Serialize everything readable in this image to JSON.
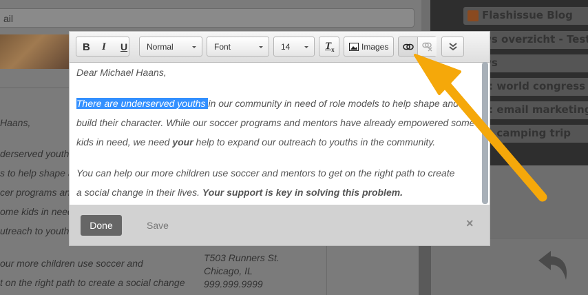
{
  "background": {
    "subject_value": "ail",
    "letter_lines": [
      "Haans,",
      "derserved youths",
      "s to help shape a",
      "cer programs an",
      "ome kids in need",
      "utreach to youths",
      "our more children use soccer and",
      "t on the right path to create a social change"
    ],
    "address": [
      "T503 Runners St.",
      "Chicago, IL",
      "999.999.9999"
    ],
    "sidebar_items": [
      "Flashissue Blog",
      "ws overzicht - Test se",
      "ws",
      "e: world congress",
      "e: email marketing",
      "e: camping trip"
    ]
  },
  "editor": {
    "toolbar": {
      "bold": "B",
      "italic": "I",
      "underline": "U",
      "format": "Normal",
      "font": "Font",
      "size": "14",
      "clear_format": "Tx",
      "images": "Images"
    },
    "content": {
      "greeting": "Dear Michael Haans,",
      "p1_selected": "There are underserved youths ",
      "p1_rest": "in our community in need of role models to help shape and",
      "p1_l2": "build their character. While our soccer programs and mentors have already empowered some",
      "p1_l3a": "kids in need, we need ",
      "p1_l3b": "your",
      "p1_l3c": " help to expand our outreach to youths in the community.",
      "p2_l1": "You can help our more children use soccer and mentors to get on the right path to create",
      "p2_l2a": "a social change in their lives. ",
      "p2_l2b": "Your support is key in solving this problem."
    },
    "footer": {
      "done": "Done",
      "save": "Save",
      "close": "×"
    }
  },
  "colors": {
    "annotation_arrow": "#f5a80a",
    "selection": "#3390ff"
  }
}
